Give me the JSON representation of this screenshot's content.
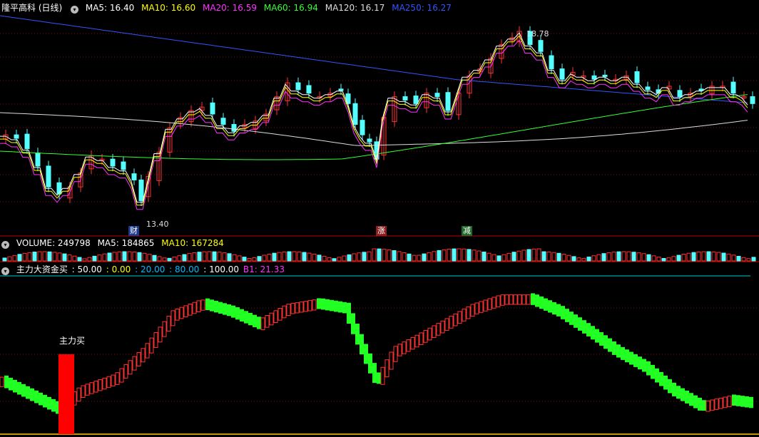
{
  "main": {
    "stock_name": "隆平高科 (日线)",
    "ma": [
      {
        "label": "MA5: 16.40",
        "color": "#ffffff"
      },
      {
        "label": "MA10: 16.60",
        "color": "#ffff00"
      },
      {
        "label": "MA20: 16.59",
        "color": "#ff33ff"
      },
      {
        "label": "MA60: 16.94",
        "color": "#33ff33"
      },
      {
        "label": "MA120: 16.17",
        "color": "#dddddd"
      },
      {
        "label": "MA250: 16.27",
        "color": "#3355ff"
      }
    ],
    "high_label": "18.78",
    "low_label": "13.40",
    "tags": [
      {
        "text": "财",
        "color": "#ffffff",
        "bg": "#1f3a8a"
      },
      {
        "text": "涨",
        "color": "#ffffff",
        "bg": "#8a1f1f"
      },
      {
        "text": "减",
        "color": "#ffffff",
        "bg": "#1f6a2a"
      }
    ]
  },
  "volume": {
    "label": "VOLUME: 249798",
    "ma5": "MA5: 184865",
    "ma10": "MA10: 167284"
  },
  "indicator": {
    "name": "主力大资金买",
    "levels": [
      {
        "text": ": 50.00",
        "color": "#ffffff"
      },
      {
        "text": ": 0.00",
        "color": "#ffff00"
      },
      {
        "text": ": 20.00",
        "color": "#00bbff"
      },
      {
        "text": ": 80.00",
        "color": "#00bbff"
      },
      {
        "text": ": 100.00",
        "color": "#ffffff"
      },
      {
        "text": "B1: 21.33",
        "color": "#ff33ff"
      }
    ],
    "buy_signal": "主力买"
  }
}
